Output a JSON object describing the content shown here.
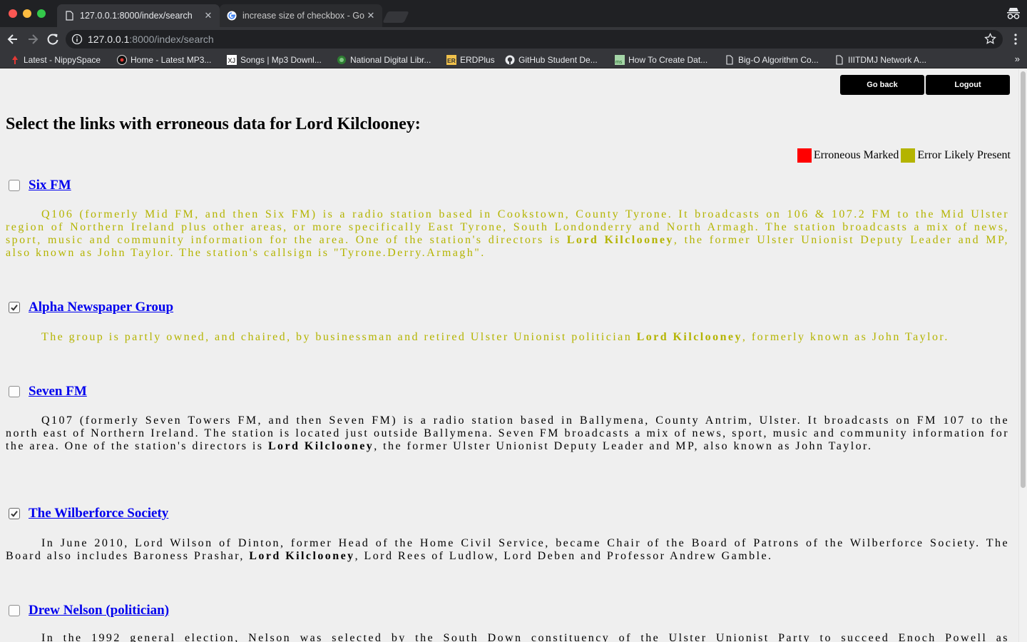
{
  "browser": {
    "tabs": [
      {
        "title": "127.0.0.1:8000/index/search",
        "active": true
      },
      {
        "title": "increase size of checkbox - Go",
        "active": false
      }
    ],
    "url": {
      "host": "127.0.0.1",
      "path": ":8000/index/search"
    },
    "bookmarks": [
      {
        "label": "Latest - NippySpace",
        "icon": "nippyspace-icon"
      },
      {
        "label": "Home - Latest MP3...",
        "icon": "record-icon"
      },
      {
        "label": "Songs | Mp3 Downl...",
        "icon": "xj-icon"
      },
      {
        "label": "National Digital Libr...",
        "icon": "ndl-icon"
      },
      {
        "label": "ERDPlus",
        "icon": "er-icon"
      },
      {
        "label": "GitHub Student De...",
        "icon": "github-icon"
      },
      {
        "label": "How To Create Dat...",
        "icon": "ms-icon"
      },
      {
        "label": "Big-O Algorithm Co...",
        "icon": "page-icon"
      },
      {
        "label": "IIITDMJ Network A...",
        "icon": "page-icon"
      }
    ],
    "bookmarks_more": "»"
  },
  "page": {
    "buttons": {
      "go_back": "Go back",
      "logout": "Logout"
    },
    "heading": "Select the links with erroneous data for Lord Kilclooney:",
    "legend": {
      "erroneous": "Erroneous Marked",
      "likely": "Error Likely Present",
      "colors": {
        "erroneous": "#ff0000",
        "likely": "#b4b400"
      }
    },
    "entries": [
      {
        "title": "Six FM",
        "checked": false,
        "status": "likely",
        "text_before": "Q106 (formerly Mid FM, and then Six FM) is a radio station based in Cookstown, County Tyrone. It broadcasts on 106 & 107.2 FM to the Mid Ulster region of Northern Ireland plus other areas, or more specifically East Tyrone, South Londonderry and North Armagh. The station broadcasts a mix of news, sport, music and community information for the area. One of the station's directors is ",
        "bold": "Lord Kilclooney",
        "text_after": ", the former Ulster Unionist Deputy Leader and MP, also known as John Taylor. The station's callsign is \"Tyrone.Derry.Armagh\"."
      },
      {
        "title": "Alpha Newspaper Group",
        "checked": true,
        "status": "likely",
        "text_before": "The group is partly owned, and chaired, by businessman and retired Ulster Unionist politician ",
        "bold": "Lord Kilclooney",
        "text_after": ", formerly known as John Taylor."
      },
      {
        "title": "Seven FM",
        "checked": false,
        "status": "normal",
        "text_before": "Q107 (formerly Seven Towers FM, and then Seven FM) is a radio station based in Ballymena, County Antrim, Ulster. It broadcasts on FM 107 to the north east of Northern Ireland. The station is located just outside Ballymena. Seven FM broadcasts a mix of news, sport, music and community information for the area. One of the station's directors is ",
        "bold": "Lord Kilclooney",
        "text_after": ", the former Ulster Unionist Deputy Leader and MP, also known as John Taylor."
      },
      {
        "title": "The Wilberforce Society",
        "checked": true,
        "status": "normal",
        "text_before": "In June 2010, Lord Wilson of Dinton, former Head of the Home Civil Service, became Chair of the Board of Patrons of the Wilberforce Society. The Board also includes Baroness Prashar, ",
        "bold": "Lord Kilclooney",
        "text_after": ", Lord Rees of Ludlow, Lord Deben and Professor Andrew Gamble."
      },
      {
        "title": "Drew Nelson (politician)",
        "checked": false,
        "status": "normal",
        "text_before": "In the 1992 general election, Nelson was selected by the South Down constituency of the Ulster Unionist Party to succeed Enoch Powell as",
        "bold": "",
        "text_after": ""
      }
    ]
  }
}
